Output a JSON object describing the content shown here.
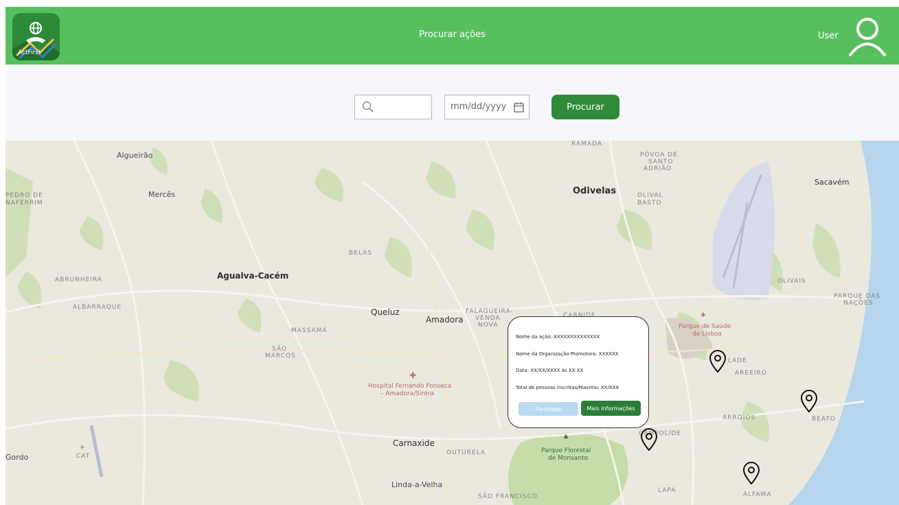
{
  "header": {
    "logo_text": "ActFirst",
    "title": "Procurar ações",
    "user_label": "User"
  },
  "search": {
    "query_value": "",
    "date_placeholder": "mm/dd/yyyy",
    "button_label": "Procurar"
  },
  "map": {
    "labels": {
      "algueirao": "Algueirão",
      "pedro_de": "PEDRO DE",
      "naferrim": "NAFERRIM",
      "merces": "Mercês",
      "ramada": "RAMADA",
      "povoa_1": "PÓVOA DE",
      "povoa_2": "SANTO",
      "povoa_3": "ADRIÃO",
      "odivelas": "Odivelas",
      "olival_1": "OLIVAL",
      "olival_2": "BASTO",
      "sacavem": "Sacavém",
      "belas": "BELAS",
      "agualva": "Agualva-Cacém",
      "abrunheira": "ABRUNHEIRA",
      "olivais": "OLIVAIS",
      "parque_nacoes_1": "PARQUE DAS",
      "parque_nacoes_2": "NAÇÕES",
      "albarraque": "ALBARRAQUE",
      "queluz": "Queluz",
      "amadora": "Amadora",
      "falagueira_1": "FALAGUEIRA-",
      "falagueira_2": "VENDA",
      "falagueira_3": "NOVA",
      "carnide": "CARNIDE",
      "parque_saude_1": "Parque de Saúde",
      "parque_saude_2": "de Lisboa",
      "massama": "MASSAMÁ",
      "sao_marcos_1": "SÃO",
      "sao_marcos_2": "MARCOS",
      "lumiar_tail": "LADE",
      "areeiro": "AREEIRO",
      "hospital_1": "Hospital Fernando Fonseca",
      "hospital_2": "– Amadora/Sintra",
      "arroios": "ARROIOS",
      "beato": "BEATO",
      "campolide": "CAMPOLIDE",
      "carnaxide": "Carnaxide",
      "outurela": "OUTURELA",
      "monsanto_1": "Parque Florestal",
      "monsanto_2": "de Monsanto",
      "gordo": "Gordo",
      "cat": "CAT",
      "linda": "Linda-a-Velha",
      "sao_francisco": "SÃO FRANCISCO",
      "lapa": "LAPA",
      "alfama": "ALFAMA"
    },
    "popup": {
      "action_name": "Nome da ação:  XXXXXXXXXXXXXX",
      "org_name": "Nome da Organização Promotora: XXXXXX",
      "date": "Data:   XX/XX/XXXX às XX:XX",
      "total": "Total de pessoas inscritas/Maximo:    XX/XXX",
      "participate_label": "Participar",
      "more_info_label": "Mais informações"
    }
  },
  "colors": {
    "header_green": "#58bf5e",
    "button_green": "#2f8a39",
    "participate_blue": "#b9daf1",
    "river": "#b6d4ec"
  }
}
